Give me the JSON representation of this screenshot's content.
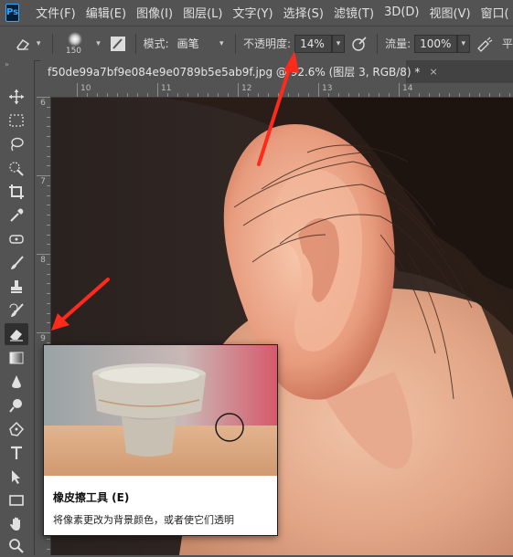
{
  "app": {
    "logo_text": "Ps"
  },
  "menu": {
    "items": [
      {
        "label": "文件(F)"
      },
      {
        "label": "编辑(E)"
      },
      {
        "label": "图像(I)"
      },
      {
        "label": "图层(L)"
      },
      {
        "label": "文字(Y)"
      },
      {
        "label": "选择(S)"
      },
      {
        "label": "滤镜(T)"
      },
      {
        "label": "3D(D)"
      },
      {
        "label": "视图(V)"
      },
      {
        "label": "窗口("
      }
    ]
  },
  "options_bar": {
    "brush_size": "150",
    "mode_label": "模式:",
    "mode_value": "画笔",
    "opacity_label": "不透明度:",
    "opacity_value": "14%",
    "flow_label": "流量:",
    "flow_value": "100%",
    "trailing_text": "平"
  },
  "document_tab": {
    "title": "f50de99a7bf9e084e9e0789b5e5ab9f.jpg @ 92.6% (图层 3, RGB/8) *",
    "close_glyph": "×"
  },
  "toolbar": {
    "collapse_glyph": "»",
    "tools": [
      {
        "name": "move-tool",
        "icon": "move-icon"
      },
      {
        "name": "marquee-tool",
        "icon": "marquee-icon"
      },
      {
        "name": "lasso-tool",
        "icon": "lasso-icon"
      },
      {
        "name": "quick-selection-tool",
        "icon": "quick-selection-icon"
      },
      {
        "name": "crop-tool",
        "icon": "crop-icon"
      },
      {
        "name": "eyedropper-tool",
        "icon": "eyedropper-icon"
      },
      {
        "name": "healing-brush-tool",
        "icon": "healing-icon"
      },
      {
        "name": "brush-tool",
        "icon": "brush-icon"
      },
      {
        "name": "clone-stamp-tool",
        "icon": "stamp-icon"
      },
      {
        "name": "history-brush-tool",
        "icon": "history-brush-icon"
      },
      {
        "name": "eraser-tool",
        "icon": "eraser-icon",
        "active": true
      },
      {
        "name": "gradient-tool",
        "icon": "gradient-icon"
      },
      {
        "name": "blur-tool",
        "icon": "blur-icon"
      },
      {
        "name": "dodge-tool",
        "icon": "dodge-icon"
      },
      {
        "name": "pen-tool",
        "icon": "pen-icon"
      },
      {
        "name": "type-tool",
        "icon": "type-icon"
      },
      {
        "name": "path-selection-tool",
        "icon": "path-selection-icon"
      },
      {
        "name": "rectangle-tool",
        "icon": "rectangle-icon"
      },
      {
        "name": "hand-tool",
        "icon": "hand-icon"
      },
      {
        "name": "zoom-tool",
        "icon": "zoom-icon"
      }
    ]
  },
  "rulers": {
    "top_labels": [
      "10",
      "11",
      "12",
      "13",
      "14"
    ],
    "left_labels": [
      "6",
      "7",
      "8",
      "9"
    ]
  },
  "tooltip": {
    "title": "橡皮擦工具 (E)",
    "description": "将像素更改为背景颜色，或者使它们透明"
  },
  "colors": {
    "ui_bg": "#535353",
    "annotation_arrow": "#ff2a1a",
    "tooltip_bg": "#ffffff"
  }
}
